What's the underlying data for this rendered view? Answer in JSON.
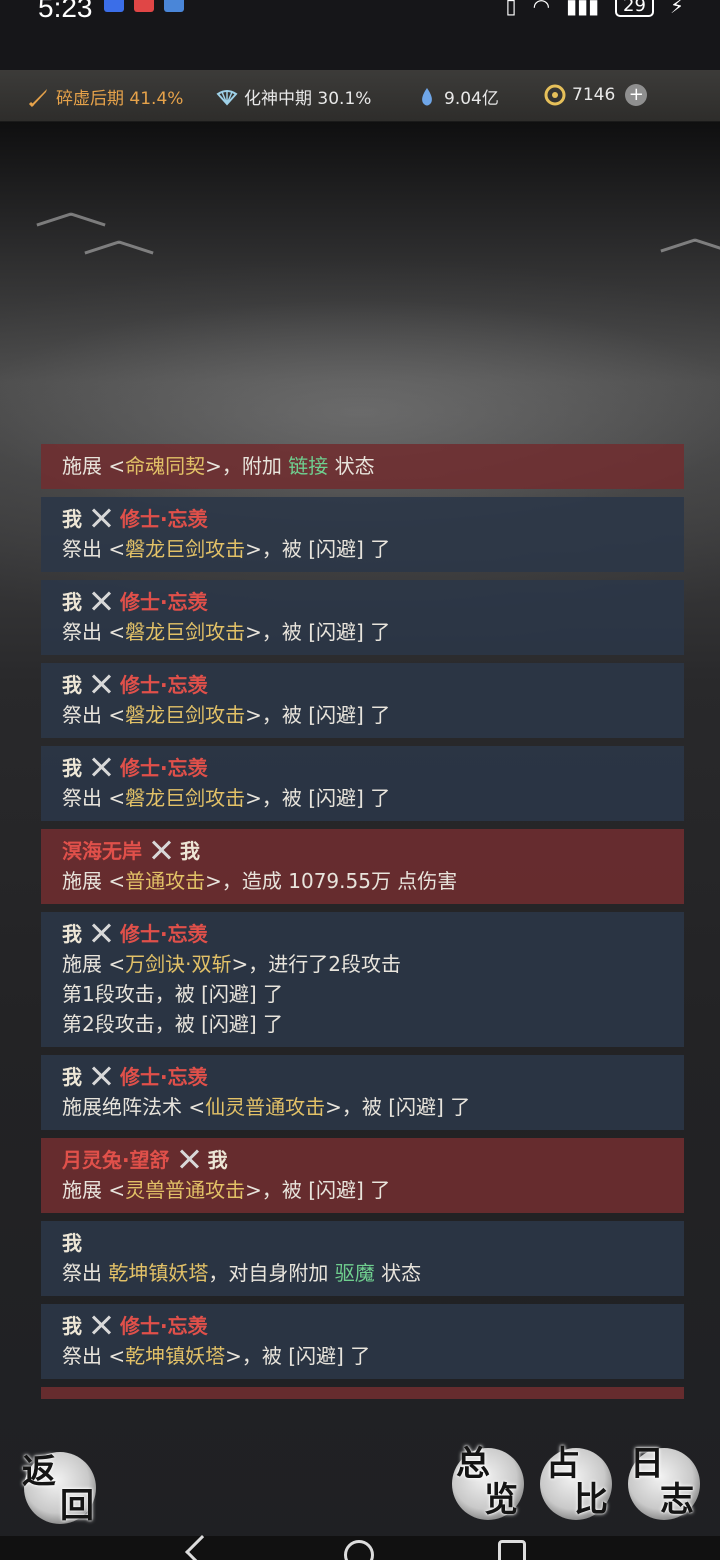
{
  "status_bar": {
    "time": "5:23",
    "battery": "29"
  },
  "resources": {
    "cultivation_main": "碎虚后期 41.4%",
    "cultivation_secondary": "化神中期 30.1%",
    "spirit_stones": "9.04亿",
    "currency": "7146",
    "plus_icon": "plus-icon"
  },
  "log": [
    {
      "type": "red",
      "header": null,
      "lines": [
        [
          [
            "",
            "施展 <"
          ],
          [
            "skill",
            "命魂同契"
          ],
          [
            "",
            ">，附加 "
          ],
          [
            "status-green",
            "链接"
          ],
          [
            "",
            " 状态"
          ]
        ]
      ]
    },
    {
      "type": "blue",
      "header": {
        "left": "我",
        "left_role": "me",
        "right": "修士·忘羡",
        "right_role": "enemy"
      },
      "lines": [
        [
          [
            "",
            "祭出 <"
          ],
          [
            "skill",
            "磐龙巨剑攻击"
          ],
          [
            "",
            ">，被 [闪避] 了"
          ]
        ]
      ]
    },
    {
      "type": "blue",
      "header": {
        "left": "我",
        "left_role": "me",
        "right": "修士·忘羡",
        "right_role": "enemy"
      },
      "lines": [
        [
          [
            "",
            "祭出 <"
          ],
          [
            "skill",
            "磐龙巨剑攻击"
          ],
          [
            "",
            ">，被 [闪避] 了"
          ]
        ]
      ]
    },
    {
      "type": "blue",
      "header": {
        "left": "我",
        "left_role": "me",
        "right": "修士·忘羡",
        "right_role": "enemy"
      },
      "lines": [
        [
          [
            "",
            "祭出 <"
          ],
          [
            "skill",
            "磐龙巨剑攻击"
          ],
          [
            "",
            ">，被 [闪避] 了"
          ]
        ]
      ]
    },
    {
      "type": "blue",
      "header": {
        "left": "我",
        "left_role": "me",
        "right": "修士·忘羡",
        "right_role": "enemy"
      },
      "lines": [
        [
          [
            "",
            "祭出 <"
          ],
          [
            "skill",
            "磐龙巨剑攻击"
          ],
          [
            "",
            ">，被 [闪避] 了"
          ]
        ]
      ]
    },
    {
      "type": "red",
      "header": {
        "left": "溟海无岸",
        "left_role": "enemy",
        "right": "我",
        "right_role": "me"
      },
      "lines": [
        [
          [
            "",
            "施展 <"
          ],
          [
            "skill",
            "普通攻击"
          ],
          [
            "",
            ">，造成 1079.55万 点伤害"
          ]
        ]
      ]
    },
    {
      "type": "blue",
      "header": {
        "left": "我",
        "left_role": "me",
        "right": "修士·忘羡",
        "right_role": "enemy"
      },
      "lines": [
        [
          [
            "",
            "施展 <"
          ],
          [
            "skill",
            "万剑诀·双斩"
          ],
          [
            "",
            ">，进行了2段攻击"
          ]
        ],
        [
          [
            "",
            "第1段攻击，被 [闪避] 了"
          ]
        ],
        [
          [
            "",
            "第2段攻击，被 [闪避] 了"
          ]
        ]
      ]
    },
    {
      "type": "blue",
      "header": {
        "left": "我",
        "left_role": "me",
        "right": "修士·忘羡",
        "right_role": "enemy"
      },
      "lines": [
        [
          [
            "",
            "施展绝阵法术 <"
          ],
          [
            "skill",
            "仙灵普通攻击"
          ],
          [
            "",
            ">，被 [闪避] 了"
          ]
        ]
      ]
    },
    {
      "type": "red",
      "header": {
        "left": "月灵兔·望舒",
        "left_role": "enemy",
        "right": "我",
        "right_role": "me"
      },
      "lines": [
        [
          [
            "",
            "施展 <"
          ],
          [
            "skill",
            "灵兽普通攻击"
          ],
          [
            "",
            ">，被 [闪避] 了"
          ]
        ]
      ]
    },
    {
      "type": "blue",
      "header": {
        "left": "我",
        "left_role": "me",
        "right": null,
        "right_role": null
      },
      "lines": [
        [
          [
            "",
            "祭出 "
          ],
          [
            "skill",
            "乾坤镇妖塔"
          ],
          [
            "",
            "，对自身附加 "
          ],
          [
            "status-green",
            "驱魔"
          ],
          [
            "",
            " 状态"
          ]
        ]
      ]
    },
    {
      "type": "blue",
      "header": {
        "left": "我",
        "left_role": "me",
        "right": "修士·忘羡",
        "right_role": "enemy"
      },
      "lines": [
        [
          [
            "",
            "祭出 <"
          ],
          [
            "skill",
            "乾坤镇妖塔"
          ],
          [
            "",
            ">，被 [闪避] 了"
          ]
        ]
      ]
    }
  ],
  "buttons": {
    "back": "返回",
    "overview": "总览",
    "ratio": "占比",
    "journal": "日志"
  }
}
